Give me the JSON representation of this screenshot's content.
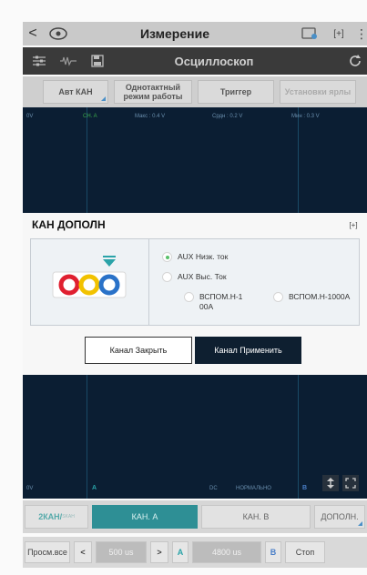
{
  "header": {
    "back_glyph": "<",
    "title": "Измерение",
    "expand_glyph": "[+]",
    "menu_glyph": "⋮"
  },
  "toolbar": {
    "title": "Осциллоскоп"
  },
  "buttons_row": {
    "auto_ch": "Авт КАН",
    "single_mode": "Однотактный режим работы",
    "trigger": "Триггер",
    "settings": "Установки ярлы"
  },
  "scope_top": {
    "left_label": "0V",
    "ch_label": "CH. A",
    "max_label": "Макс : 0.4 V",
    "avg_label": "Срдн : 0.2 V",
    "min_label": "Мин : 0.3 V"
  },
  "dialog": {
    "title": "КАН ДОПОЛН",
    "expand_glyph": "[+]",
    "options": [
      {
        "label": "AUX Низк. ток",
        "selected": true
      },
      {
        "label": "AUX Выс. Ток",
        "selected": false
      },
      {
        "label": "ВСПОМ.Н-100А",
        "selected": false
      },
      {
        "label": "ВСПОМ.Н-1000А",
        "selected": false
      }
    ],
    "close_label": "Канал Закрыть",
    "apply_label": "Канал Применить"
  },
  "scope_bottom": {
    "left_label": "0V",
    "a_label": "A",
    "dc_label": "DC",
    "normal_label": "НОРМАЛЬНО",
    "b_label": "B"
  },
  "channels": {
    "ch2_label": "2КАН/",
    "ch2_sub": "SKAH",
    "ch_a": "КАН. A",
    "ch_b": "КАН. B",
    "aux": "ДОПОЛН."
  },
  "nav": {
    "view_all": "Просм.все",
    "prev_glyph": "<",
    "time_a": "500 us",
    "next_glyph": ">",
    "a_letter": "A",
    "time_b": "4800 us",
    "b_letter": "B",
    "stop": "Стоп"
  },
  "colors": {
    "scope_bg": "#0b1e33",
    "accent_teal": "#2e8f95",
    "apply_bg": "#0e1f30",
    "radio_on": "#58c06a",
    "plug_red": "#e02030",
    "plug_yellow": "#f2c200",
    "plug_blue": "#2a72c8",
    "marker_teal": "#2aa3a8"
  }
}
